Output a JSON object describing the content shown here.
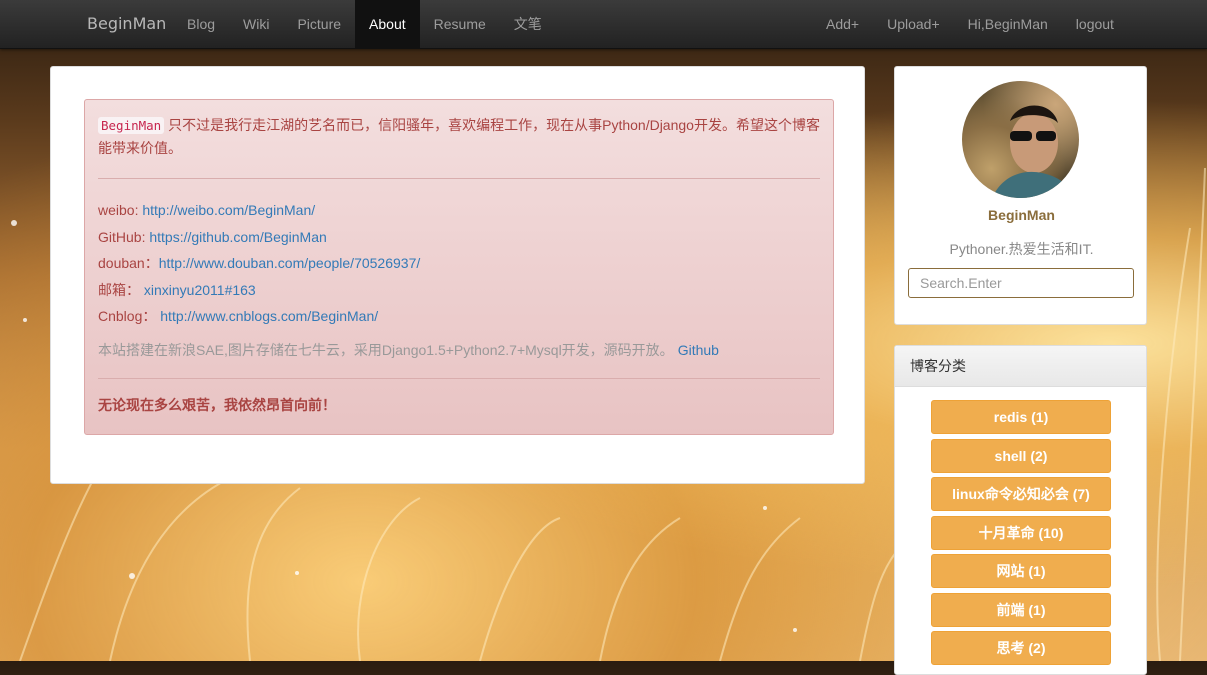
{
  "navbar": {
    "brand": "BeginMan",
    "left_items": [
      {
        "label": "Blog",
        "active": false
      },
      {
        "label": "Wiki",
        "active": false
      },
      {
        "label": "Picture",
        "active": false
      },
      {
        "label": "About",
        "active": true
      },
      {
        "label": "Resume",
        "active": false
      },
      {
        "label": "文笔",
        "active": false
      }
    ],
    "right_items": [
      {
        "label": "Add+"
      },
      {
        "label": "Upload+"
      },
      {
        "label": "Hi,BeginMan"
      },
      {
        "label": "logout"
      }
    ]
  },
  "about": {
    "name_code": "BeginMan",
    "intro": "只不过是我行走江湖的艺名而已，信阳骚年，喜欢编程工作，现在从事Python/Django开发。希望这个博客能带来价值。",
    "links": [
      {
        "label": "weibo: ",
        "value": "http://weibo.com/BeginMan/"
      },
      {
        "label": "GitHub: ",
        "value": "https://github.com/BeginMan"
      },
      {
        "label": "douban：",
        "value": "http://www.douban.com/people/70526937/"
      },
      {
        "label": "邮箱： ",
        "value": "xinxinyu2011#163"
      },
      {
        "label": "Cnblog： ",
        "value": "http://www.cnblogs.com/BeginMan/"
      }
    ],
    "note": "本站搭建在新浪SAE,图片存储在七牛云，采用Django1.5+Python2.7+Mysql开发，源码开放。",
    "note_link": "Github",
    "motto": "无论现在多么艰苦，我依然昂首向前！"
  },
  "profile": {
    "name": "BeginMan",
    "description": "Pythoner.热爱生活和IT.",
    "search_placeholder": "Search.Enter"
  },
  "categories": {
    "heading": "博客分类",
    "items": [
      {
        "label": "redis (1)"
      },
      {
        "label": "shell (2)"
      },
      {
        "label": "linux命令必知必会 (7)"
      },
      {
        "label": "十月革命 (10)"
      },
      {
        "label": "网站 (1)"
      },
      {
        "label": "前端 (1)"
      },
      {
        "label": "思考 (2)"
      }
    ]
  },
  "colors": {
    "navbar_bg": "#222222",
    "alert_bg": "#f2dede",
    "alert_text": "#a94442",
    "link": "#337ab7",
    "category_button": "#f0ad4e",
    "profile_name": "#8a6d3b"
  }
}
